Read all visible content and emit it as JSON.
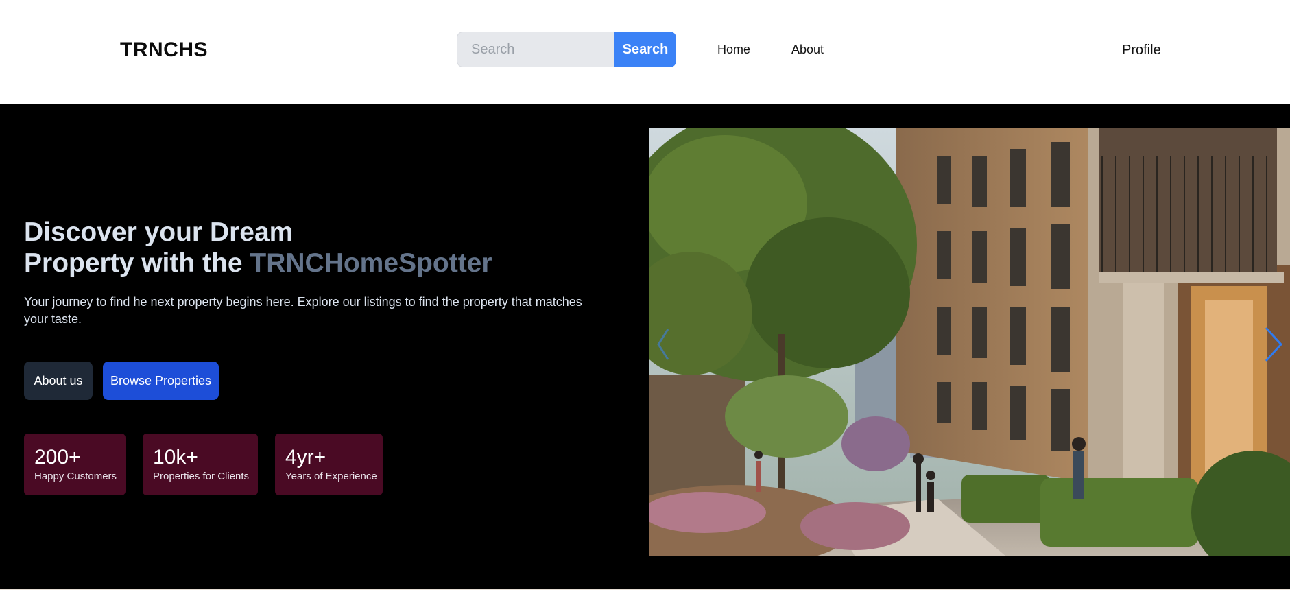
{
  "header": {
    "logo": "TRNCHS",
    "search": {
      "placeholder": "Search",
      "value": "",
      "button_label": "Search"
    },
    "nav": {
      "home": "Home",
      "about": "About"
    },
    "profile": "Profile"
  },
  "hero": {
    "title_line1": "Discover your Dream",
    "title_line2_prefix": "Property with the ",
    "title_accent": "TRNCHomeSpotter",
    "subtitle": "Your journey to find he next property begins here. Explore our listings to find the property that matches your taste.",
    "buttons": {
      "about": "About us",
      "browse": "Browse Properties"
    },
    "stats": [
      {
        "value": "200+",
        "label": "Happy Customers"
      },
      {
        "value": "10k+",
        "label": "Properties for Clients"
      },
      {
        "value": "4yr+",
        "label": "Years of Experience"
      }
    ]
  },
  "carousel": {
    "prev_icon": "chevron-left-icon",
    "next_icon": "chevron-right-icon",
    "image_subject": "apartment-courtyard-photo"
  },
  "colors": {
    "accent_blue": "#3b82f6",
    "browse_blue": "#1d4ed8",
    "stat_bg": "#4a0a24",
    "hero_bg": "#000000",
    "title_accent": "#64748b"
  }
}
